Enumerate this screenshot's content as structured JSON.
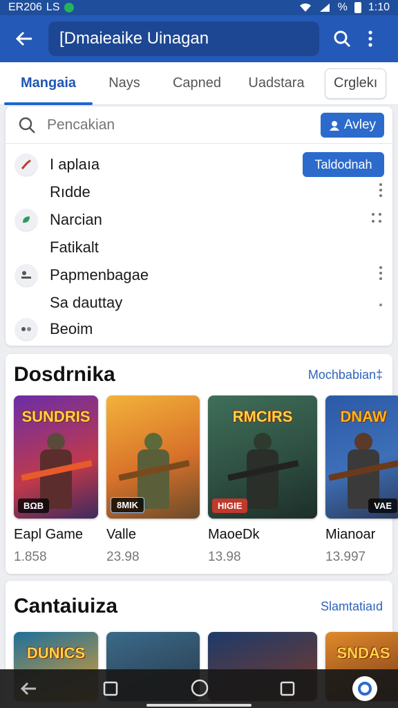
{
  "status_bar": {
    "time_left": "ER206",
    "carrier": "LS",
    "right_text": "%",
    "clock": "1:10"
  },
  "app_bar": {
    "title": "[Dmaieaike Uinagan"
  },
  "tabs": [
    {
      "label": "Mangaia"
    },
    {
      "label": "Nays"
    },
    {
      "label": "Capned"
    },
    {
      "label": "Uadstara"
    },
    {
      "label": "Crglekı"
    }
  ],
  "search": {
    "placeholder": "Pencakian",
    "apply_label": "Avley"
  },
  "filter_list": {
    "connect_label": "Taldodnah",
    "items": [
      {
        "label": "I aplaıa",
        "icon": "chart-icon"
      },
      {
        "label": "Rıdde",
        "icon": ""
      },
      {
        "label": "Narcian",
        "icon": "leaf-icon"
      },
      {
        "label": "Fatikalt",
        "icon": ""
      },
      {
        "label": "Papmenbagae",
        "icon": "people-icon"
      },
      {
        "label": "Sa dauttay",
        "icon": ""
      },
      {
        "label": "Beoim",
        "icon": "dots-icon"
      }
    ]
  },
  "section1": {
    "title": "Dosdrnika",
    "link": "Mochbabian‡",
    "games": [
      {
        "name": "Eapl Game",
        "size": "1.858",
        "cover_text": "SUNDRIS",
        "badge": "BΩB"
      },
      {
        "name": "Valle",
        "size": "23.98",
        "cover_text": "",
        "badge": "8MIK"
      },
      {
        "name": "MaoeDk",
        "size": "13.98",
        "cover_text": "RMCIRS",
        "badge": "HIGIE"
      },
      {
        "name": "Mianoar",
        "size": "13.997",
        "cover_text": "DNAW",
        "badge": "VAE"
      }
    ]
  },
  "section2": {
    "title": "Cantaiuiza",
    "link": "Slamtatiaıd",
    "covers": [
      {
        "cover_text": "DUNICS"
      },
      {
        "cover_text": ""
      },
      {
        "cover_text": ""
      },
      {
        "cover_text": "SNDAS"
      }
    ]
  },
  "colors": {
    "primary": "#2559b7",
    "accent": "#2c6bcc",
    "link": "#2e64b9"
  }
}
